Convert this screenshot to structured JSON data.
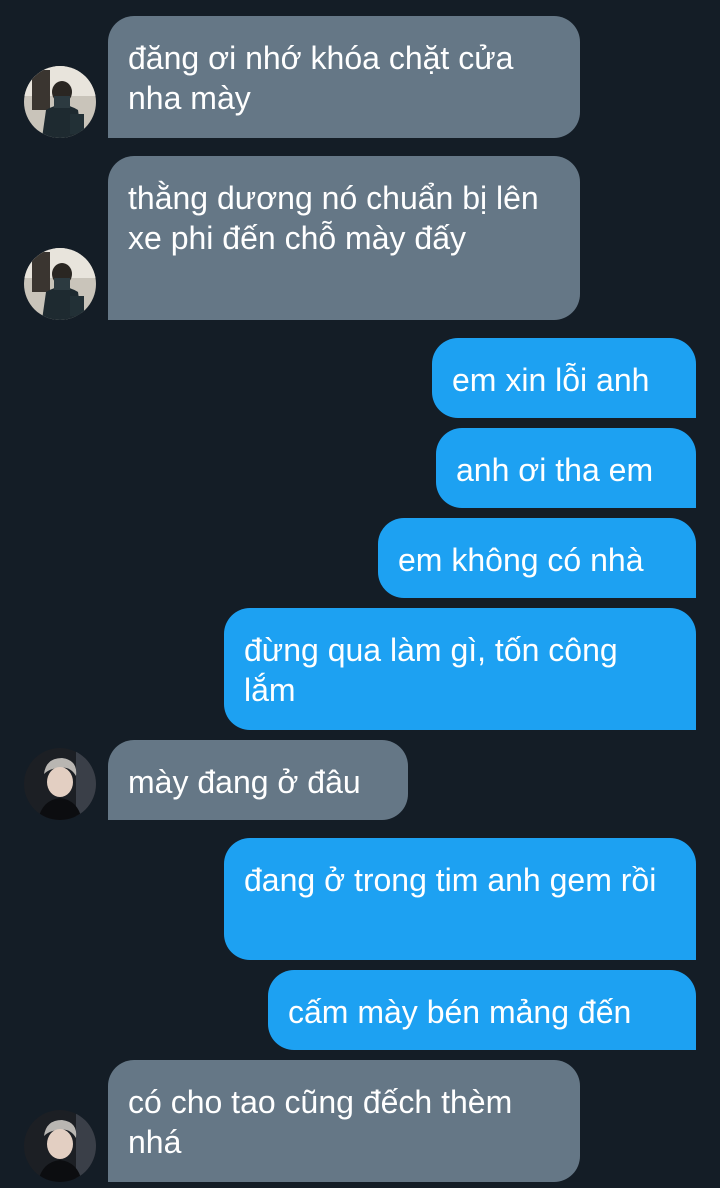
{
  "colors": {
    "background": "#141d26",
    "incoming_bubble": "#657786",
    "outgoing_bubble": "#1da1f2",
    "text": "#ffffff"
  },
  "messages": [
    {
      "direction": "incoming",
      "text": "đăng ơi nhớ khóa chặt cửa nha mày",
      "avatar": "avatar-photo-a"
    },
    {
      "direction": "incoming",
      "text": "thằng dương nó chuẩn bị lên xe phi đến chỗ mày đấy",
      "avatar": "avatar-photo-a"
    },
    {
      "direction": "outgoing",
      "text": "em xin lỗi anh"
    },
    {
      "direction": "outgoing",
      "text": "anh ơi tha em"
    },
    {
      "direction": "outgoing",
      "text": "em không có nhà"
    },
    {
      "direction": "outgoing",
      "text": "đừng qua làm gì, tốn công lắm"
    },
    {
      "direction": "incoming",
      "text": "mày đang ở đâu",
      "avatar": "avatar-photo-b"
    },
    {
      "direction": "outgoing",
      "text": "đang ở trong tim anh gem rồi"
    },
    {
      "direction": "outgoing",
      "text": "cấm mày bén mảng đến"
    },
    {
      "direction": "incoming",
      "text": "có cho tao cũng đếch thèm nhá",
      "avatar": "avatar-photo-b"
    }
  ]
}
